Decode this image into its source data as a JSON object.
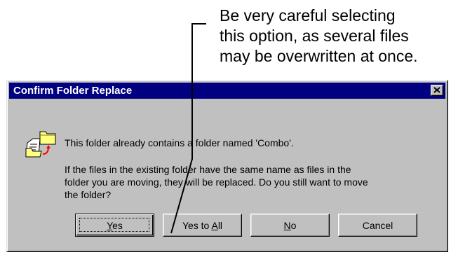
{
  "callout": {
    "lines": [
      "Be very careful selecting",
      "this option, as several files",
      "may be overwritten at once."
    ]
  },
  "dialog": {
    "title": "Confirm Folder Replace",
    "message1": "This folder already contains a folder named 'Combo'.",
    "message2_lines": [
      "If the files in the existing folder have the same name as files in the",
      "folder you are moving, they will be replaced.  Do you still want to move",
      "the folder?"
    ],
    "buttons": {
      "yes": {
        "pre": "",
        "accel": "Y",
        "post": "es"
      },
      "yes_to_all": {
        "pre": "Yes to ",
        "accel": "A",
        "post": "ll"
      },
      "no": {
        "pre": "",
        "accel": "N",
        "post": "o"
      },
      "cancel": {
        "pre": "Cancel",
        "accel": "",
        "post": ""
      }
    }
  },
  "icons": {
    "close": "close-icon",
    "folder_replace": "folder-replace-icon"
  },
  "colors": {
    "titlebar": "#000080",
    "face": "#c0c0c0"
  }
}
